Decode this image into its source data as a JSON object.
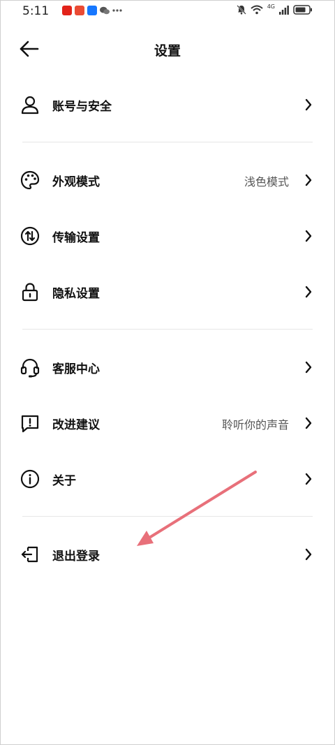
{
  "status_bar": {
    "time": "5:11",
    "network": "4G",
    "apps": [
      "app-icon-red",
      "app-icon-orange",
      "app-icon-blue",
      "wechat-icon",
      "more-dots"
    ]
  },
  "header": {
    "title": "设置"
  },
  "settings": [
    {
      "key": "account",
      "label": "账号与安全",
      "value": "",
      "icon": "user-icon"
    },
    {
      "key": "appearance",
      "label": "外观模式",
      "value": "浅色模式",
      "icon": "palette-icon"
    },
    {
      "key": "transfer",
      "label": "传输设置",
      "value": "",
      "icon": "transfer-icon"
    },
    {
      "key": "privacy",
      "label": "隐私设置",
      "value": "",
      "icon": "lock-icon"
    },
    {
      "key": "support",
      "label": "客服中心",
      "value": "",
      "icon": "headset-icon"
    },
    {
      "key": "feedback",
      "label": "改进建议",
      "value": "聆听你的声音",
      "icon": "feedback-icon"
    },
    {
      "key": "about",
      "label": "关于",
      "value": "",
      "icon": "info-icon"
    },
    {
      "key": "logout",
      "label": "退出登录",
      "value": "",
      "icon": "logout-icon"
    }
  ],
  "annotation": {
    "arrow_color": "#e8707a"
  }
}
